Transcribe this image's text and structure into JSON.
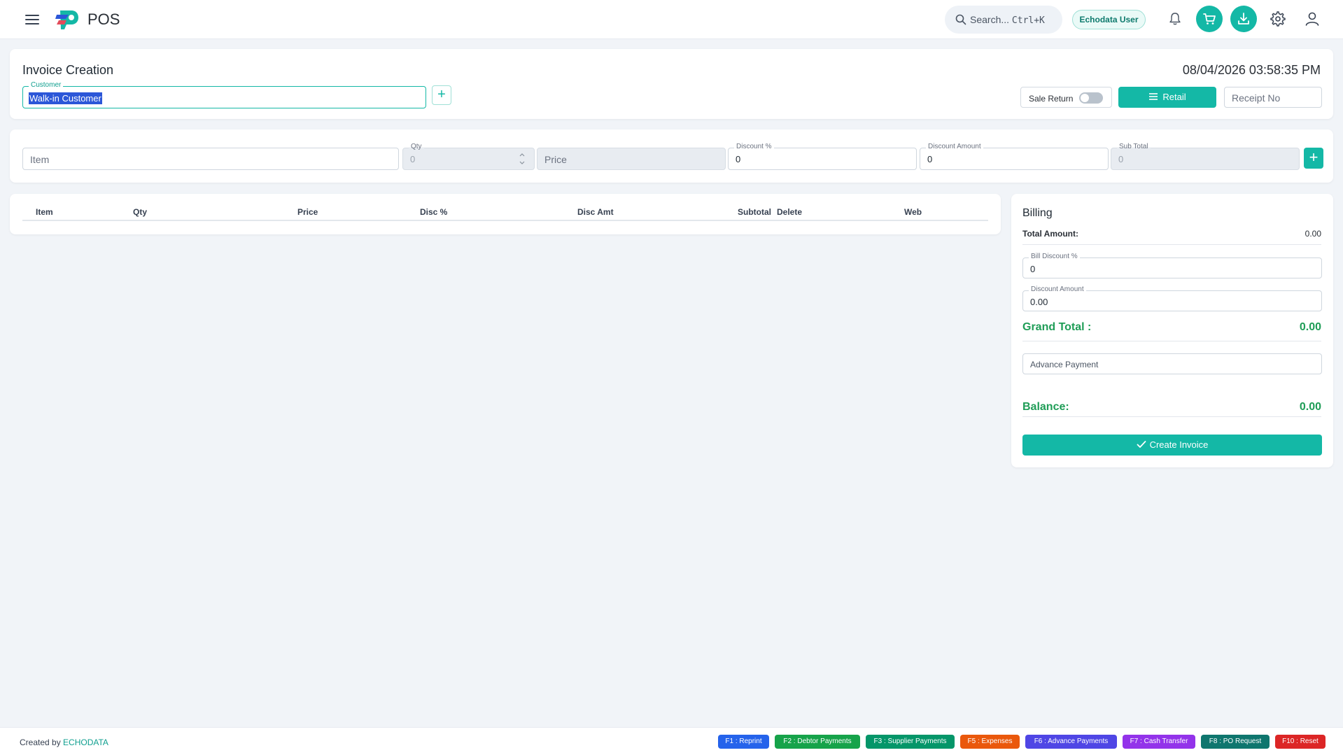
{
  "header": {
    "app_title": "POS",
    "search": {
      "label": "Search...",
      "shortcut": "Ctrl+K"
    },
    "user_chip": "Echodata User",
    "icons": [
      "menu-icon",
      "bell-icon",
      "cart-icon",
      "download-icon",
      "gear-icon",
      "user-icon"
    ],
    "accent_color": "#14b8a6"
  },
  "invoice": {
    "title": "Invoice Creation",
    "datetime": "08/04/2026 03:58:35 PM",
    "customer": {
      "legend": "Customer",
      "value": "Walk-in Customer"
    },
    "sale_return": {
      "label": "Sale Return",
      "checked": false
    },
    "mode_button": "Retail",
    "receipt_placeholder": "Receipt No"
  },
  "item_entry": {
    "item_placeholder": "Item",
    "qty": {
      "legend": "Qty",
      "value": "0"
    },
    "price_placeholder": "Price",
    "discount_pct": {
      "legend": "Discount %",
      "value": "0"
    },
    "discount_amount": {
      "legend": "Discount Amount",
      "value": "0"
    },
    "sub_total": {
      "legend": "Sub Total",
      "value": "0"
    }
  },
  "table": {
    "columns": [
      "Item",
      "Qty",
      "Price",
      "Disc %",
      "Disc Amt",
      "Subtotal",
      "Delete",
      "Web"
    ],
    "rows": []
  },
  "billing": {
    "title": "Billing",
    "total_amount_label": "Total Amount:",
    "total_amount_value": "0.00",
    "bill_discount": {
      "legend": "Bill Discount %",
      "value": "0"
    },
    "discount_amount": {
      "legend": "Discount Amount",
      "value": "0.00"
    },
    "grand_total_label": "Grand Total :",
    "grand_total_value": "0.00",
    "advance_payment_placeholder": "Advance Payment",
    "balance_label": "Balance:",
    "balance_value": "0.00",
    "create_button": "Create Invoice"
  },
  "footer": {
    "created_by": "Created by",
    "brand": "ECHODATA",
    "shortcuts": [
      {
        "label": "F1 : Reprint",
        "color": "#2563eb"
      },
      {
        "label": "F2 : Debtor Payments",
        "color": "#16a34a"
      },
      {
        "label": "F3 : Supplier Payments",
        "color": "#059669"
      },
      {
        "label": "F5 : Expenses",
        "color": "#ea580c"
      },
      {
        "label": "F6 : Advance Payments",
        "color": "#4f46e5"
      },
      {
        "label": "F7 : Cash Transfer",
        "color": "#9333ea"
      },
      {
        "label": "F8 : PO Request",
        "color": "#0f766e"
      },
      {
        "label": "F10 : Reset",
        "color": "#dc2626"
      }
    ]
  }
}
